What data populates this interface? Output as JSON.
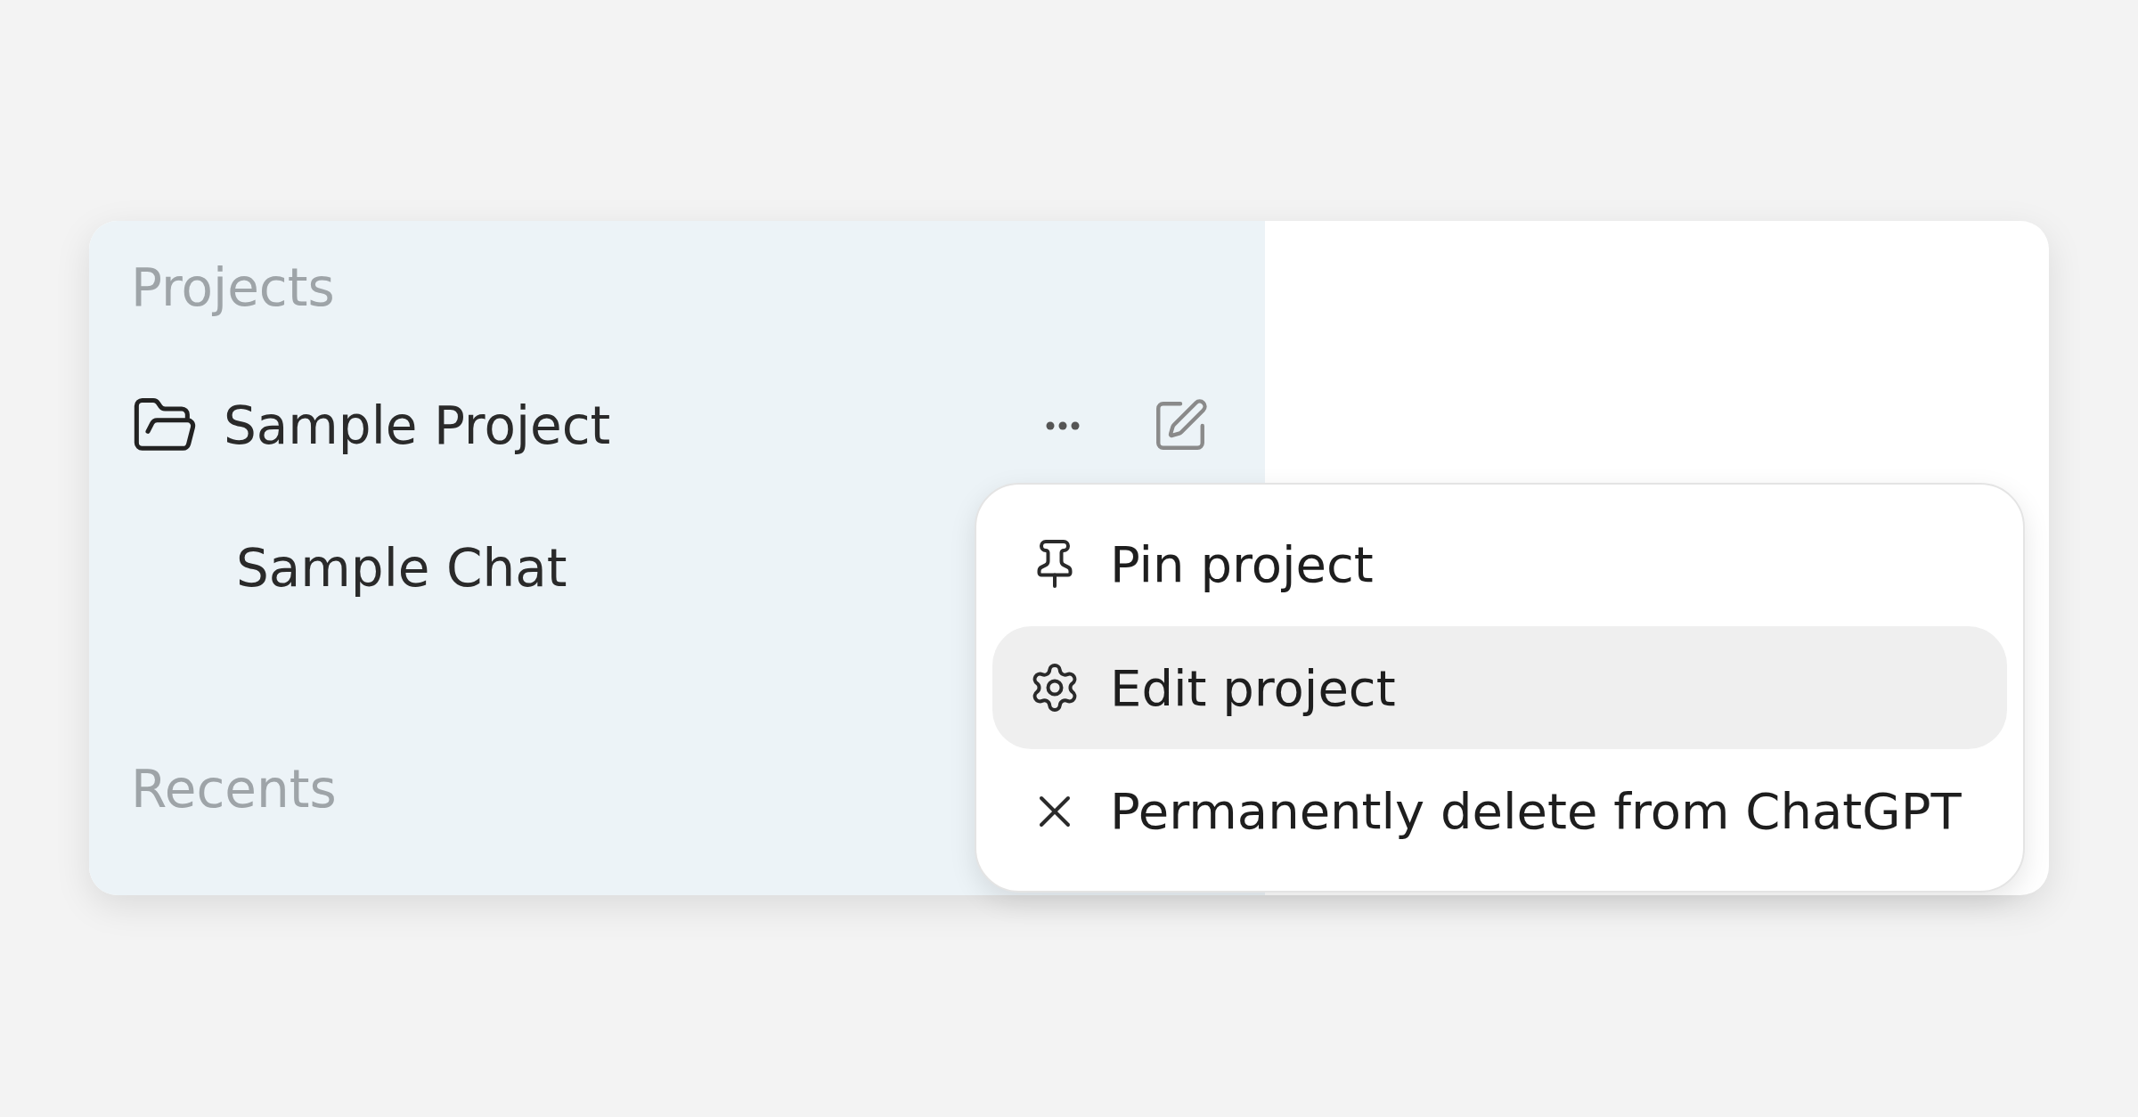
{
  "sidebar": {
    "sections": [
      {
        "title": "Projects",
        "items": [
          {
            "kind": "project",
            "label": "Sample Project"
          },
          {
            "kind": "chat",
            "label": "Sample Chat"
          }
        ]
      },
      {
        "title": "Recents"
      }
    ]
  },
  "menu": {
    "items": [
      {
        "kind": "pin",
        "label": "Pin project",
        "selected": false
      },
      {
        "kind": "settings",
        "label": "Edit project",
        "selected": true
      },
      {
        "kind": "delete",
        "label": "Permanently delete from ChatGPT",
        "selected": false
      }
    ]
  }
}
